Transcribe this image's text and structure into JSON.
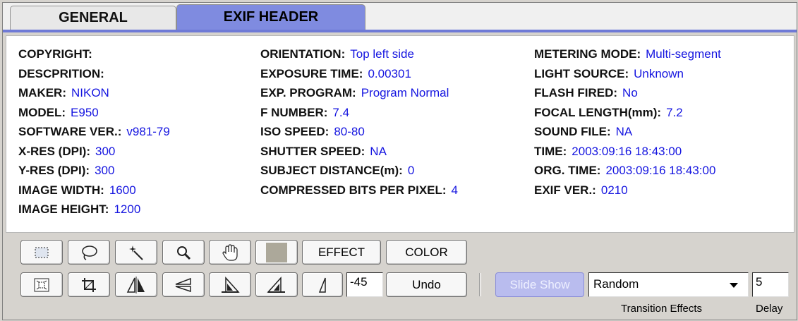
{
  "tabs": [
    {
      "label": "GENERAL",
      "active": false
    },
    {
      "label": "EXIF HEADER",
      "active": true
    }
  ],
  "colors": {
    "accent": "#7f8be0",
    "value_text": "#1515e0",
    "panel_bg": "#ffffff"
  },
  "exif": {
    "col1": [
      {
        "label": "COPYRIGHT:",
        "value": ""
      },
      {
        "label": "DESCPRITION:",
        "value": ""
      },
      {
        "label": "MAKER:",
        "value": "NIKON"
      },
      {
        "label": "MODEL:",
        "value": "E950"
      },
      {
        "label": "SOFTWARE VER.:",
        "value": "v981-79"
      },
      {
        "label": "X-RES (DPI):",
        "value": "300"
      },
      {
        "label": "Y-RES (DPI):",
        "value": "300"
      },
      {
        "label": "IMAGE WIDTH:",
        "value": "1600"
      },
      {
        "label": "IMAGE HEIGHT:",
        "value": "1200"
      }
    ],
    "col2": [
      {
        "label": "ORIENTATION:",
        "value": "Top left side"
      },
      {
        "label": "EXPOSURE TIME:",
        "value": "0.00301"
      },
      {
        "label": "EXP. PROGRAM:",
        "value": "Program Normal"
      },
      {
        "label": "F NUMBER:",
        "value": "7.4"
      },
      {
        "label": "ISO SPEED:",
        "value": "80-80"
      },
      {
        "label": "SHUTTER SPEED:",
        "value": "NA"
      },
      {
        "label": "SUBJECT DISTANCE(m):",
        "value": "0"
      },
      {
        "label": "COMPRESSED BITS PER PIXEL:",
        "value": "4"
      }
    ],
    "col3": [
      {
        "label": "METERING MODE:",
        "value": "Multi-segment"
      },
      {
        "label": "LIGHT SOURCE:",
        "value": "Unknown"
      },
      {
        "label": "FLASH FIRED:",
        "value": "No"
      },
      {
        "label": "FOCAL LENGTH(mm):",
        "value": "7.2"
      },
      {
        "label": "SOUND FILE:",
        "value": "NA"
      },
      {
        "label": "TIME:",
        "value": "2003:09:16 18:43:00"
      },
      {
        "label": "ORG. TIME:",
        "value": "2003:09:16 18:43:00"
      },
      {
        "label": "EXIF VER.:",
        "value": "0210"
      }
    ]
  },
  "toolbar": {
    "row1_icons": [
      "rect-select-icon",
      "lasso-icon",
      "magic-wand-icon",
      "zoom-icon",
      "hand-pan-icon",
      "color-swatch-icon"
    ],
    "row2_icons": [
      "fit-to-window-icon",
      "crop-icon",
      "flip-horizontal-icon",
      "flip-vertical-icon",
      "rotate-left-icon",
      "rotate-right-icon",
      "rotate-angle-icon"
    ],
    "effect_label": "EFFECT",
    "color_label": "COLOR",
    "angle_value": "-45",
    "undo_label": "Undo",
    "swatch_color": "#aca89a"
  },
  "slideshow": {
    "button_label": "Slide Show",
    "enabled": false,
    "transition_selected": "Random",
    "transition_caption": "Transition Effects",
    "delay_value": "5",
    "delay_caption": "Delay"
  }
}
